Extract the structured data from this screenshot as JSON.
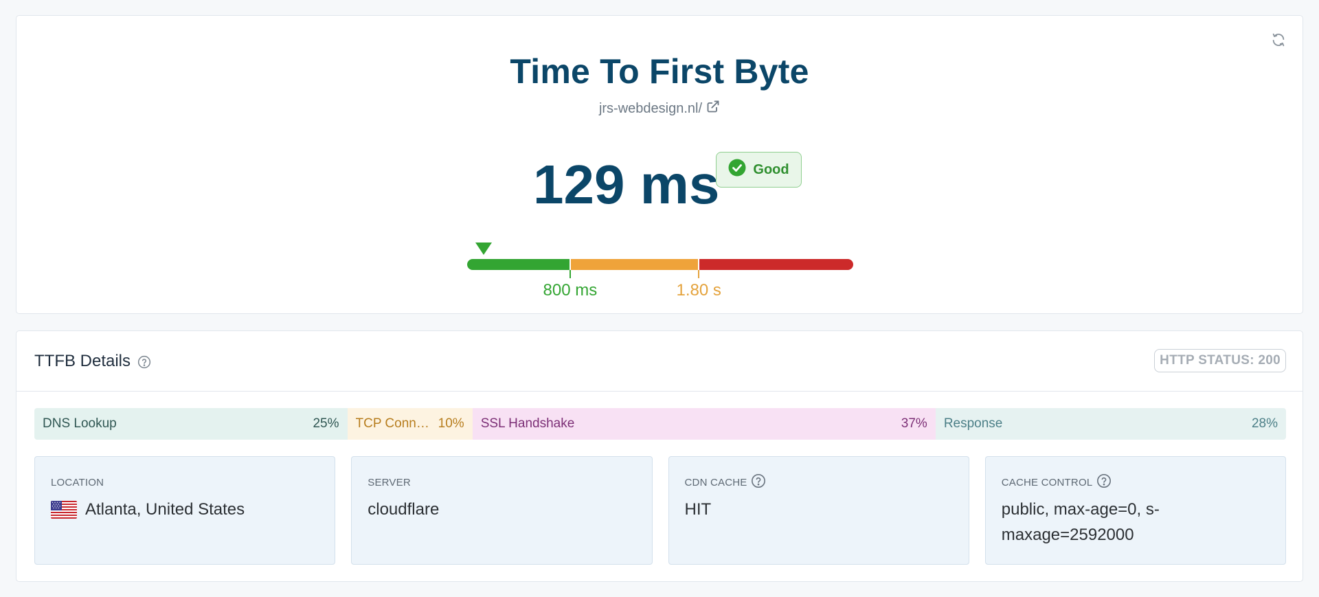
{
  "header": {
    "title": "Time To First Byte",
    "url": "jrs-webdesign.nl/",
    "refresh_icon": "refresh-icon",
    "external_icon": "external-link-icon"
  },
  "metric": {
    "value": "129 ms",
    "value_ms": 129,
    "rating": "Good",
    "rating_icon": "check-circle-icon",
    "colors": {
      "good": "#33a532",
      "needs_improvement": "#efa33a",
      "poor": "#cc2a2a"
    }
  },
  "gauge": {
    "max_ms": 3000,
    "marker_ms": 129,
    "thresholds": [
      {
        "ms": 800,
        "label": "800 ms",
        "color": "#33a532"
      },
      {
        "ms": 1800,
        "label": "1.80 s",
        "color": "#e4a23b"
      }
    ],
    "segments": [
      {
        "from_ms": 0,
        "to_ms": 800,
        "color": "#33a532"
      },
      {
        "from_ms": 800,
        "to_ms": 1800,
        "color": "#efa33a"
      },
      {
        "from_ms": 1800,
        "to_ms": 3000,
        "color": "#cc2a2a"
      }
    ]
  },
  "details": {
    "title": "TTFB Details",
    "help_icon": "help-circle-icon",
    "http_status": "HTTP STATUS: 200",
    "breakdown": [
      {
        "label": "DNS Lookup",
        "pct_label": "25%",
        "pct": 25,
        "bg": "#e4f2ef",
        "fg": "#2f5652"
      },
      {
        "label": "TCP Connection",
        "pct_label": "10%",
        "pct": 10,
        "bg": "#fdf3e1",
        "fg": "#b77d1d"
      },
      {
        "label": "SSL Handshake",
        "pct_label": "37%",
        "pct": 37,
        "bg": "#f8e1f4",
        "fg": "#7c2f76"
      },
      {
        "label": "Response",
        "pct_label": "28%",
        "pct": 28,
        "bg": "#e6f2f1",
        "fg": "#4c7f87"
      }
    ],
    "boxes": [
      {
        "label": "LOCATION",
        "value": "Atlanta, United States",
        "icon": "us-flag-icon"
      },
      {
        "label": "SERVER",
        "value": "cloudflare"
      },
      {
        "label": "CDN CACHE",
        "value": "HIT",
        "icon": "help-circle-icon"
      },
      {
        "label": "CACHE CONTROL",
        "value": "public, max-age=0, s-maxage=2592000",
        "icon": "help-circle-icon"
      }
    ]
  }
}
